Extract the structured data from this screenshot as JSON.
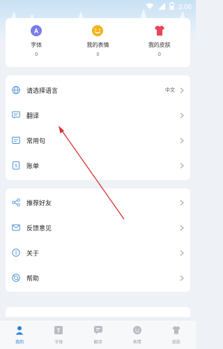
{
  "status_bar": {
    "time": "3:06"
  },
  "stats": [
    {
      "label": "字体",
      "count": "0",
      "icon": "font-a-icon"
    },
    {
      "label": "我的表情",
      "count": "0",
      "icon": "smiley-icon"
    },
    {
      "label": "我的皮肤",
      "count": "0",
      "icon": "shirt-icon"
    }
  ],
  "menu1": [
    {
      "label": "请选择语言",
      "extra": "中文",
      "icon": "globe-icon"
    },
    {
      "label": "翻译",
      "extra": "",
      "icon": "translate-chat-icon"
    },
    {
      "label": "常用句",
      "extra": "",
      "icon": "phrase-icon"
    },
    {
      "label": "账单",
      "extra": "",
      "icon": "bill-icon"
    }
  ],
  "menu2": [
    {
      "label": "推荐好友",
      "icon": "share-icon"
    },
    {
      "label": "反馈意见",
      "icon": "mail-icon"
    },
    {
      "label": "关于",
      "icon": "info-icon"
    },
    {
      "label": "帮助",
      "icon": "help-icon"
    }
  ],
  "tabs": [
    {
      "label": "我的",
      "active": true
    },
    {
      "label": "字体",
      "active": false
    },
    {
      "label": "翻译",
      "active": false
    },
    {
      "label": "表情",
      "active": false
    },
    {
      "label": "皮肤",
      "active": false
    }
  ],
  "colors": {
    "accent": "#2d7fd8",
    "arrow": "#d6322e",
    "font_icon": "#7b7ce8",
    "smiley_icon": "#f2b51c",
    "shirt_icon": "#e8455a"
  }
}
